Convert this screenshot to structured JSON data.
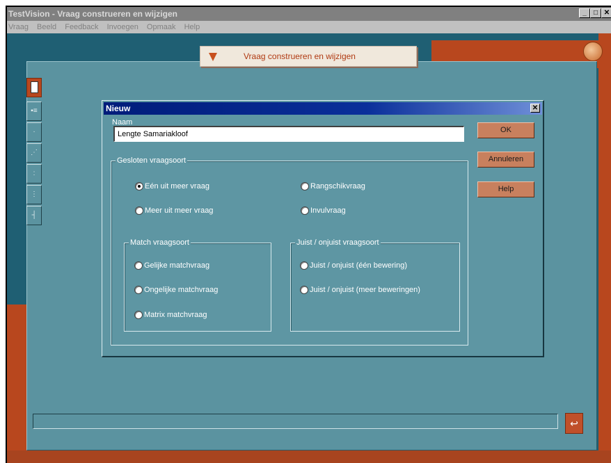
{
  "window": {
    "title": "TestVision - Vraag construeren en wijzigen",
    "min": "_",
    "max": "□",
    "close": "✕"
  },
  "menu": [
    "Vraag",
    "Beeld",
    "Feedback",
    "Invoegen",
    "Opmaak",
    "Help"
  ],
  "banner": {
    "title": "Vraag construeren en wijzigen"
  },
  "dialog": {
    "title": "Nieuw",
    "close": "✕",
    "naam_label": "Naam",
    "naam_value": "Lengte Samariakloof",
    "ok": "OK",
    "cancel": "Annuleren",
    "help": "Help",
    "gesloten": {
      "label": "Gesloten vraagsoort",
      "options": {
        "een_uit_meer": "Eén uit meer vraag",
        "meer_uit_meer": "Meer uit meer vraag",
        "rangschik": "Rangschikvraag",
        "invul": "Invulvraag"
      }
    },
    "match": {
      "label": "Match vraagsoort",
      "options": {
        "gelijke": "Gelijke matchvraag",
        "ongelijke": "Ongelijke matchvraag",
        "matrix": "Matrix matchvraag"
      }
    },
    "juist": {
      "label": "Juist / onjuist vraagsoort",
      "options": {
        "een": "Juist / onjuist (één bewering)",
        "meer": "Juist / onjuist (meer beweringen)"
      }
    },
    "selected": "een_uit_meer"
  },
  "toolbar_icons": [
    "new-question-icon",
    "list-icon",
    "dot-icon",
    "image-icon",
    "colon-icon",
    "table-icon",
    "split-icon"
  ],
  "colors": {
    "accent": "#b8471e",
    "panel": "#5b93a0",
    "dialog_title": "#001c7a"
  }
}
